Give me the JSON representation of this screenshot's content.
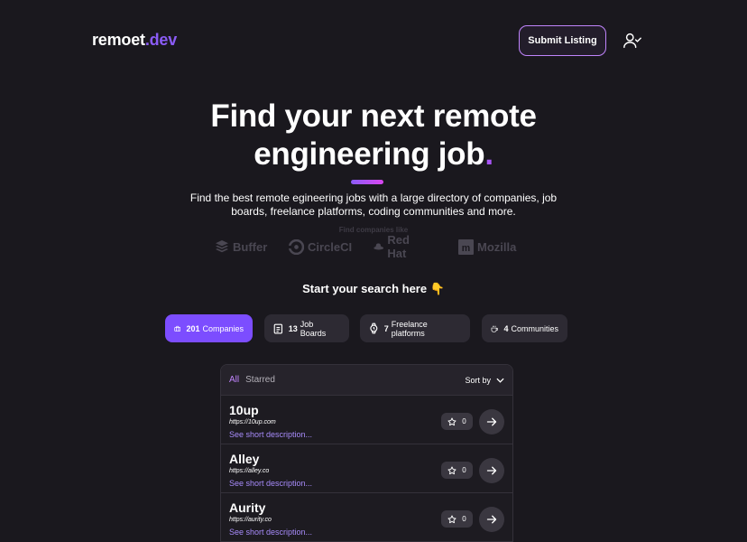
{
  "header": {
    "logo_main": "remoet",
    "logo_accent": ".dev",
    "submit_label": "Submit Listing"
  },
  "hero": {
    "line1": "Find your next remote",
    "line2": "engineering job",
    "dot": ".",
    "subtitle": "Find the best remote egineering jobs with a large directory of companies, job boards, freelance platforms, coding communities and more.",
    "find_like": "Find companies like",
    "brands": [
      "Buffer",
      "CircleCI",
      "Red Hat",
      "Mozilla"
    ]
  },
  "search": {
    "heading": "Start your search here 👇",
    "tabs": [
      {
        "count": "201",
        "label": "Companies"
      },
      {
        "count": "13",
        "label": "Job Boards"
      },
      {
        "count": "7",
        "label": "Freelance platforms"
      },
      {
        "count": "4",
        "label": "Communities"
      }
    ]
  },
  "list": {
    "filter_all": "All",
    "filter_starred": "Starred",
    "sort_label": "Sort by",
    "rows": [
      {
        "name": "10up",
        "url": "https://10up.com",
        "desc": "See short description...",
        "stars": "0"
      },
      {
        "name": "Alley",
        "url": "https://alley.co",
        "desc": "See short description...",
        "stars": "0"
      },
      {
        "name": "Aurity",
        "url": "https://aurity.co",
        "desc": "See short description...",
        "stars": "0"
      }
    ]
  },
  "colors": {
    "background": "#1a181e",
    "accent": "#8b5cf6",
    "active_tab": "#7c4dff",
    "link": "#a78bfa"
  }
}
